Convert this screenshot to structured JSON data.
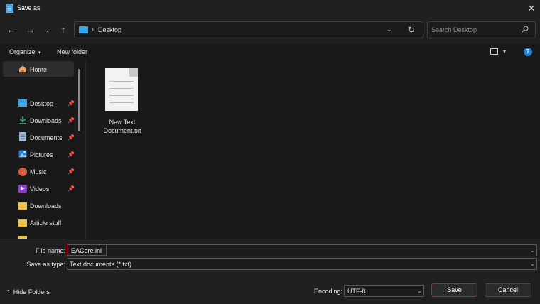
{
  "window": {
    "title": "Save as"
  },
  "address": {
    "location": "Desktop"
  },
  "search": {
    "placeholder": "Search Desktop"
  },
  "toolbar": {
    "organize": "Organize",
    "new_folder": "New folder"
  },
  "sidebar": {
    "items": [
      {
        "label": "Home",
        "icon": "home-icon",
        "pinned": false
      },
      {
        "label": "Desktop",
        "icon": "desktop-folder-icon",
        "pinned": true
      },
      {
        "label": "Downloads",
        "icon": "download-icon",
        "pinned": true
      },
      {
        "label": "Documents",
        "icon": "documents-icon",
        "pinned": true
      },
      {
        "label": "Pictures",
        "icon": "pictures-icon",
        "pinned": true
      },
      {
        "label": "Music",
        "icon": "music-icon",
        "pinned": true
      },
      {
        "label": "Videos",
        "icon": "videos-icon",
        "pinned": true
      },
      {
        "label": "Downloads",
        "icon": "folder-icon",
        "pinned": false
      },
      {
        "label": "Article stuff",
        "icon": "folder-icon",
        "pinned": false
      }
    ]
  },
  "files": [
    {
      "name_line1": "New Text",
      "name_line2": "Document.txt",
      "icon": "text-document-icon"
    }
  ],
  "form": {
    "file_name_label": "File name:",
    "file_name_value": "EACore.ini",
    "save_type_label": "Save as type:",
    "save_type_value": "Text documents (*.txt)",
    "encoding_label": "Encoding:",
    "encoding_value": "UTF-8"
  },
  "buttons": {
    "hide_folders": "Hide Folders",
    "save": "Save",
    "cancel": "Cancel"
  },
  "colors": {
    "accent_blue": "#37a5e6",
    "highlight_red": "#e81123",
    "background": "#191919"
  }
}
